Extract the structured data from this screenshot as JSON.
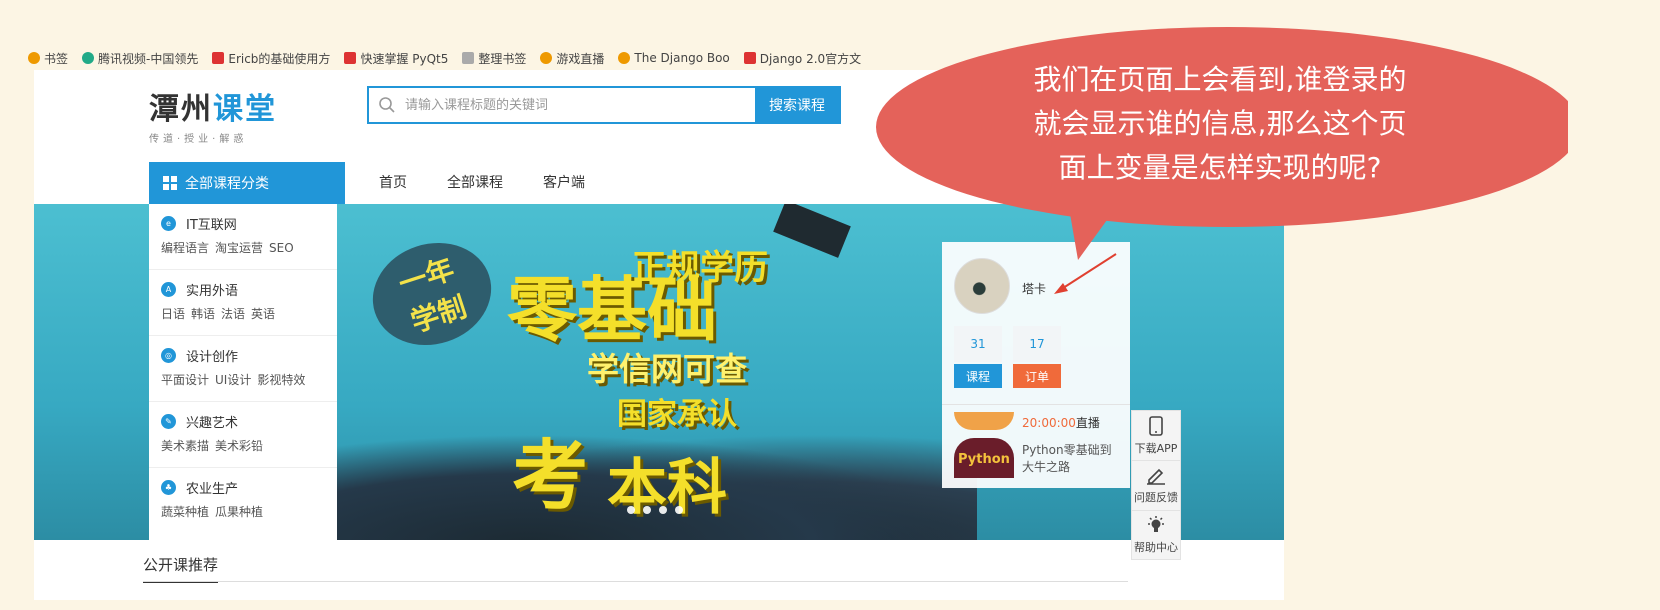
{
  "bookmarks": [
    {
      "label": "书签",
      "color": "orange"
    },
    {
      "label": "腾讯视频-中国领先",
      "color": "green"
    },
    {
      "label": "Ericb的基础使用方",
      "color": "red"
    },
    {
      "label": "快速掌握 PyQt5",
      "color": "red"
    },
    {
      "label": "整理书签",
      "color": "gray"
    },
    {
      "label": "游戏直播",
      "color": "orange"
    },
    {
      "label": "The Django Boo",
      "color": "orange"
    },
    {
      "label": "Django 2.0官方文",
      "color": "red"
    }
  ],
  "logo": {
    "title_main": "潭州",
    "title_accent": "课堂",
    "subtitle": "传道·授业·解惑"
  },
  "search": {
    "placeholder": "请输入课程标题的关键词",
    "button": "搜索课程"
  },
  "nav": {
    "all_categories": "全部课程分类",
    "items": [
      "首页",
      "全部课程",
      "客户端"
    ]
  },
  "categories": [
    {
      "title": "IT互联网",
      "icon": "globe-icon",
      "tags": [
        "编程语言",
        "淘宝运营",
        "SEO"
      ]
    },
    {
      "title": "实用外语",
      "icon": "language-icon",
      "tags": [
        "日语",
        "韩语",
        "法语",
        "英语"
      ]
    },
    {
      "title": "设计创作",
      "icon": "design-icon",
      "tags": [
        "平面设计",
        "UI设计",
        "影视特效"
      ]
    },
    {
      "title": "兴趣艺术",
      "icon": "brush-icon",
      "tags": [
        "美术素描",
        "美术彩铅"
      ]
    },
    {
      "title": "农业生产",
      "icon": "plant-icon",
      "tags": [
        "蔬菜种植",
        "瓜果种植"
      ]
    }
  ],
  "banner": {
    "bubble_line1": "一年",
    "bubble_line2": "学制",
    "line_zero_basis": "零基础",
    "line_formal": "正规学历",
    "line_chsi": "学信网可查",
    "line_national": "国家承认",
    "line_kao": "考",
    "line_benke": "本科",
    "dot_count": 4
  },
  "user": {
    "name": "塔卡",
    "courses_count": "31",
    "orders_count": "17",
    "courses_label": "课程",
    "orders_label": "订单",
    "live_time": "20:00:00",
    "live_label": "直播",
    "live_thumb_text": "Python",
    "live_course": "Python零基础到大牛之路"
  },
  "side_tools": [
    {
      "label": "下载APP",
      "icon": "phone-icon"
    },
    {
      "label": "问题反馈",
      "icon": "edit-icon"
    },
    {
      "label": "帮助中心",
      "icon": "lightbulb-icon"
    }
  ],
  "section": {
    "open_courses": "公开课推荐"
  },
  "annotation": {
    "line1": "我们在页面上会看到,谁登录的",
    "line2": "就会显示谁的信息,那么这个页",
    "line3": "面上变量是怎样实现的呢?",
    "bubble_color": "#e4625a"
  },
  "colors": {
    "accent": "#2196d8",
    "orange": "#f06a3a",
    "banner": "#4cbfd1"
  }
}
